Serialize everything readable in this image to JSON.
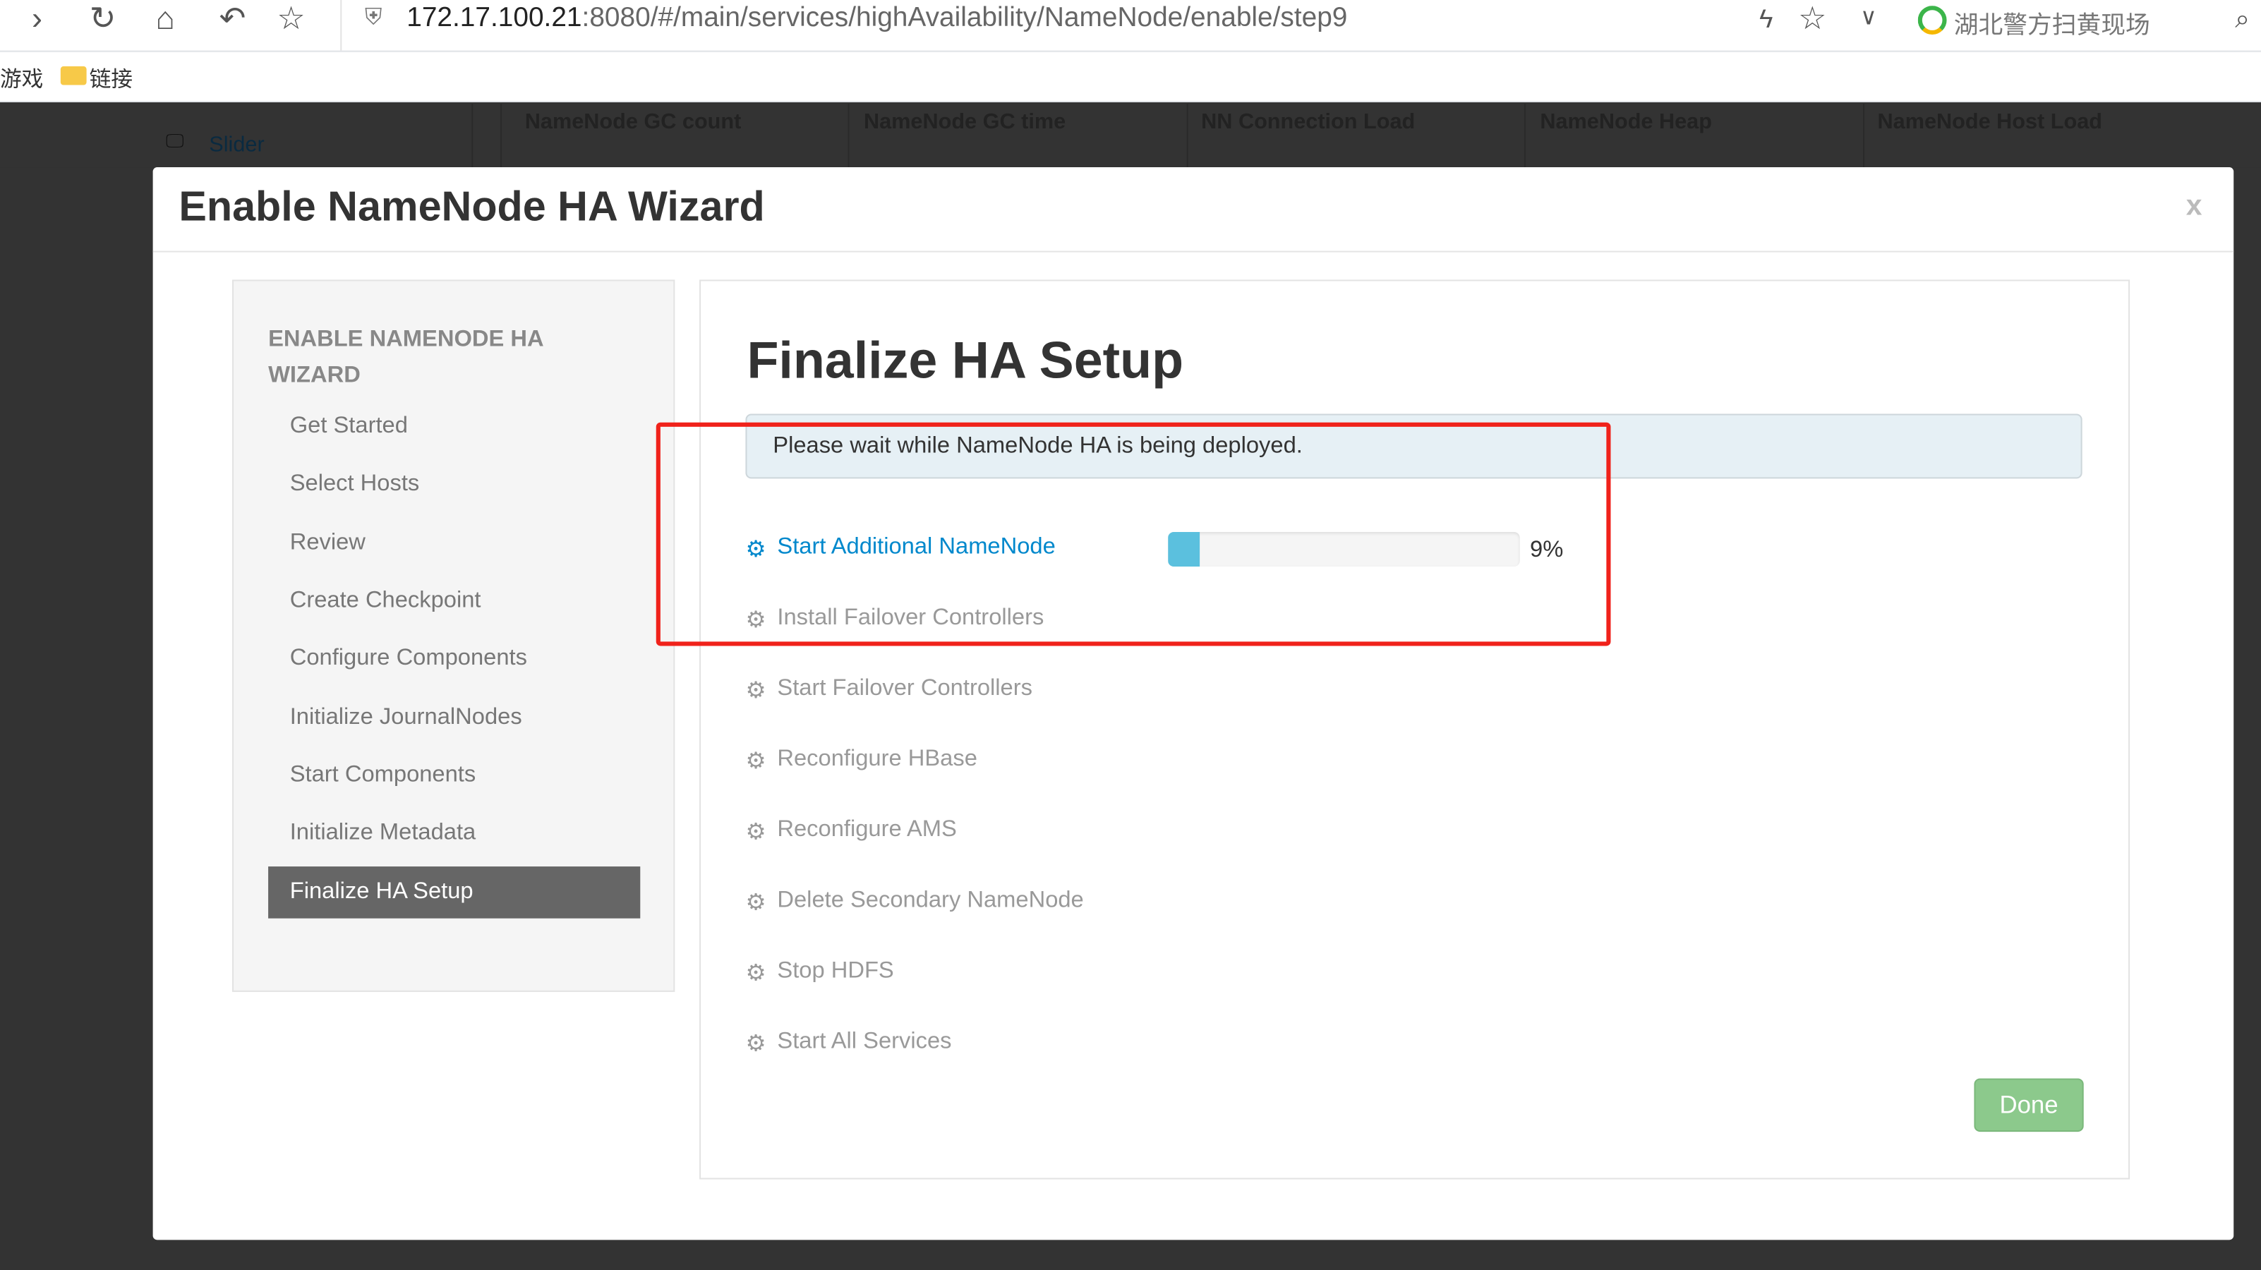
{
  "browser": {
    "url_host": "172.17.100.21",
    "url_rest": ":8080/#/main/services/highAvailability/NameNode/enable/step9",
    "search_suggestion": "湖北警方扫黄现场",
    "bookmarks": [
      "游戏",
      "链接"
    ]
  },
  "background": {
    "slider_label": "Slider",
    "columns": [
      "NameNode GC count",
      "NameNode GC time",
      "NN Connection Load",
      "NameNode Heap",
      "NameNode Host Load"
    ]
  },
  "modal": {
    "title": "Enable NameNode HA Wizard",
    "close_label": "x",
    "sidebar": {
      "heading": "ENABLE NAMENODE HA WIZARD",
      "items": [
        {
          "label": "Get Started"
        },
        {
          "label": "Select Hosts"
        },
        {
          "label": "Review"
        },
        {
          "label": "Create Checkpoint"
        },
        {
          "label": "Configure Components"
        },
        {
          "label": "Initialize JournalNodes"
        },
        {
          "label": "Start Components"
        },
        {
          "label": "Initialize Metadata"
        },
        {
          "label": "Finalize HA Setup",
          "active": true
        }
      ]
    },
    "content": {
      "title": "Finalize HA Setup",
      "alert": "Please wait while NameNode HA is being deployed.",
      "tasks": [
        {
          "label": "Start Additional NameNode",
          "status": "in_progress",
          "progress_percent": 9,
          "progress_label": "9%"
        },
        {
          "label": "Install Failover Controllers",
          "status": "pending"
        },
        {
          "label": "Start Failover Controllers",
          "status": "pending"
        },
        {
          "label": "Reconfigure HBase",
          "status": "pending"
        },
        {
          "label": "Reconfigure AMS",
          "status": "pending"
        },
        {
          "label": "Delete Secondary NameNode",
          "status": "pending"
        },
        {
          "label": "Stop HDFS",
          "status": "pending"
        },
        {
          "label": "Start All Services",
          "status": "pending"
        }
      ],
      "done_label": "Done"
    }
  },
  "colors": {
    "active_task": "#0088cc",
    "progress": "#5bc0de",
    "done_button": "#8cc98c",
    "annotation": "#f0221b"
  }
}
